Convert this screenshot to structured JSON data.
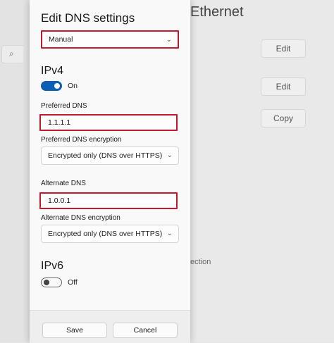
{
  "background": {
    "window_title": "Ethernet",
    "search_icon_glyph": "⌕",
    "edit1_label": "Edit",
    "edit2_label": "Edit",
    "copy_label": "Copy",
    "partial_text": "ection"
  },
  "dialog": {
    "title": "Edit DNS settings",
    "mode_value": "Manual",
    "chevron_glyph": "⌄",
    "ipv4": {
      "heading": "IPv4",
      "toggle_state": "On",
      "preferred_label": "Preferred DNS",
      "preferred_value": "1.1.1.1",
      "preferred_enc_label": "Preferred DNS encryption",
      "preferred_enc_value": "Encrypted only (DNS over HTTPS)",
      "alternate_label": "Alternate DNS",
      "alternate_value": "1.0.0.1",
      "alternate_enc_label": "Alternate DNS encryption",
      "alternate_enc_value": "Encrypted only (DNS over HTTPS)"
    },
    "ipv6": {
      "heading": "IPv6",
      "toggle_state": "Off"
    },
    "save_label": "Save",
    "cancel_label": "Cancel"
  },
  "colors": {
    "accent": "#0a5fb4",
    "highlight_outline": "#c21a2c"
  }
}
